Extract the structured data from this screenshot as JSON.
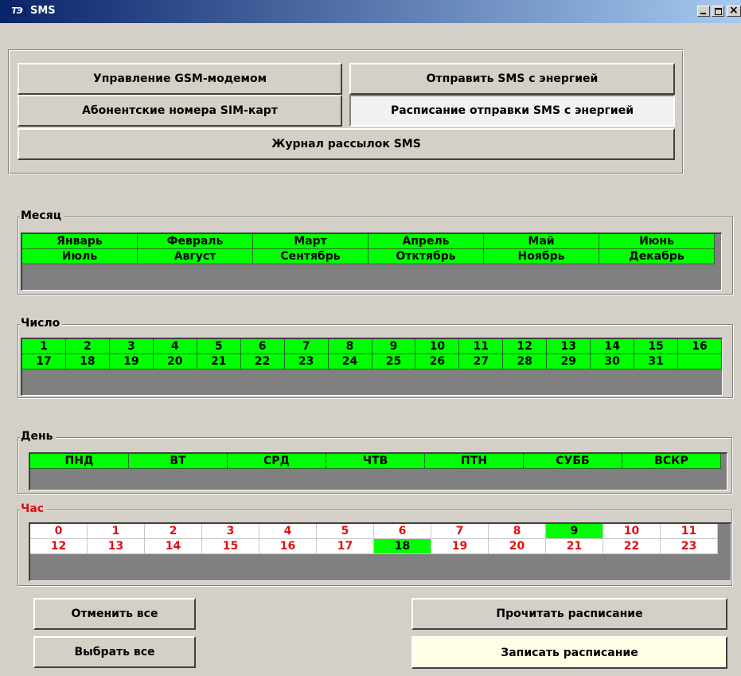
{
  "window": {
    "title": "SMS",
    "icon": "TЭ",
    "icon_name": "app-logo-icon"
  },
  "nav": {
    "gsm_modem": "Управление GSM-модемом",
    "send_sms": "Отправить SMS с энергией",
    "sim_numbers": "Абонентские номера SIM-карт",
    "schedule": "Расписание отправки SMS с энергией",
    "log": "Журнал рассылок SMS",
    "selected": "schedule"
  },
  "month": {
    "label": "Месяц",
    "rows": [
      [
        "Январь",
        "Февраль",
        "Март",
        "Апрель",
        "Май",
        "Июнь"
      ],
      [
        "Июль",
        "Август",
        "Сентябрь",
        "Отктябрь",
        "Ноябрь",
        "Декабрь"
      ]
    ]
  },
  "day_of_month": {
    "label": "Число",
    "rows": [
      [
        "1",
        "2",
        "3",
        "4",
        "5",
        "6",
        "7",
        "8",
        "9",
        "10",
        "11",
        "12",
        "13",
        "14",
        "15",
        "16"
      ],
      [
        "17",
        "18",
        "19",
        "20",
        "21",
        "22",
        "23",
        "24",
        "25",
        "26",
        "27",
        "28",
        "29",
        "30",
        "31",
        ""
      ]
    ]
  },
  "weekday": {
    "label": "День",
    "rows": [
      [
        "ПНД",
        "ВТ",
        "СРД",
        "ЧТВ",
        "ПТН",
        "СУББ",
        "ВСКР"
      ]
    ]
  },
  "hour": {
    "label": "Час",
    "rows": [
      [
        "0",
        "1",
        "2",
        "3",
        "4",
        "5",
        "6",
        "7",
        "8",
        "9",
        "10",
        "11"
      ],
      [
        "12",
        "13",
        "14",
        "15",
        "16",
        "17",
        "18",
        "19",
        "20",
        "21",
        "22",
        "23"
      ]
    ],
    "selected": [
      "9",
      "18"
    ]
  },
  "actions": {
    "clear_all": "Отменить все",
    "select_all": "Выбрать все",
    "read_schedule": "Прочитать расписание",
    "write_schedule": "Записать расписание"
  },
  "colors": {
    "selected_cell": "#00ff00",
    "unselected_text": "#e01010",
    "window_bg": "#d4d0c8"
  }
}
